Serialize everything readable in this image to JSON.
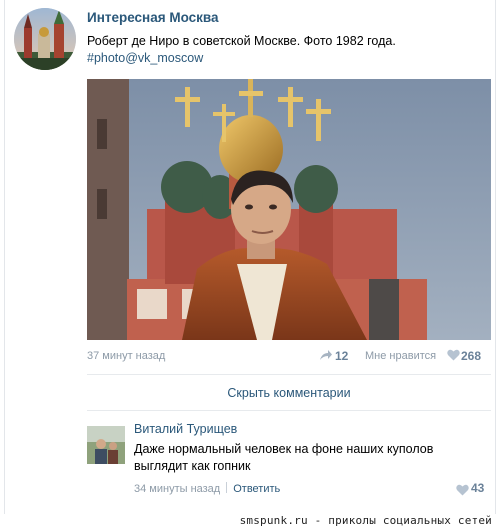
{
  "post": {
    "group_name": "Интересная Москва",
    "text": "Роберт де Ниро в советской Москве. Фото 1982 года.",
    "tag": "#photo@vk_moscow",
    "photo_icon": "photo-kremlin-church-portrait",
    "time": "37 минут назад",
    "share_count": "12",
    "like_label": "Мне нравится",
    "like_count": "268"
  },
  "comments_toggle": "Скрыть комментарии",
  "comment": {
    "author": "Виталий Турищев",
    "text": "Даже нормальный человек на фоне наших куполов выглядит как гопник",
    "time": "34 минуты назад",
    "reply_label": "Ответить",
    "like_count": "43"
  },
  "watermark": "smspunk.ru - приколы социальных сетей",
  "colors": {
    "link": "#2b587a",
    "meta": "#8d9aa7",
    "count": "#6b8299"
  }
}
